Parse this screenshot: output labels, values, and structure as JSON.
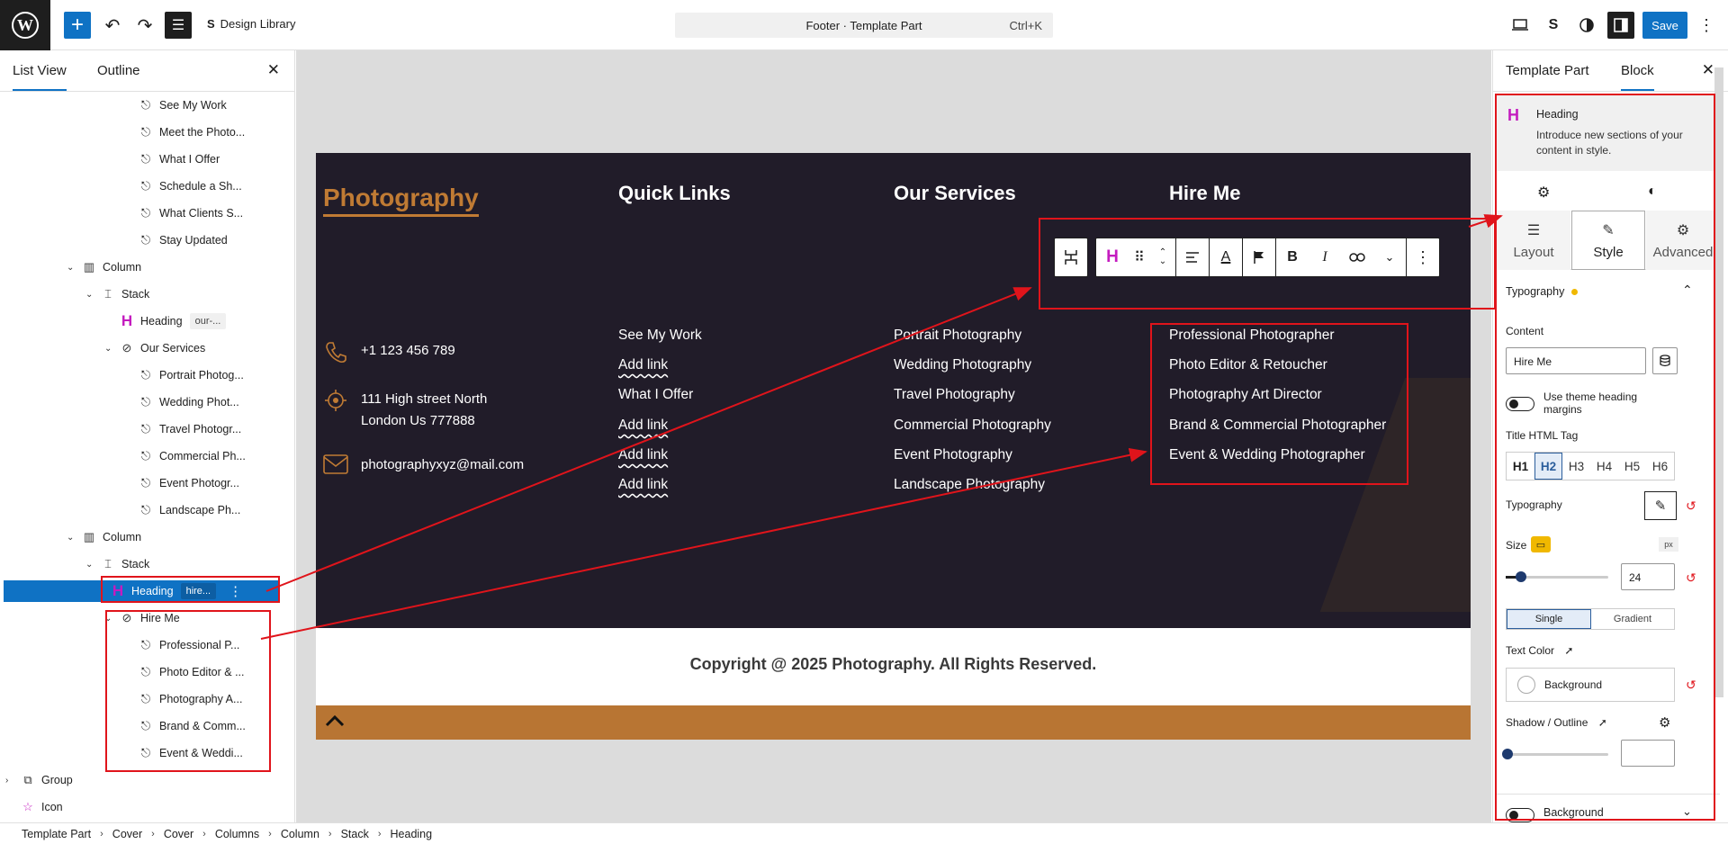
{
  "topbar": {
    "logo": "W",
    "add_icon": "+",
    "undo_icon": "↶",
    "redo_icon": "↷",
    "list_view_icon": "☰",
    "design_library_icon": "S",
    "design_library_label": "Design Library",
    "command_title": "Footer · Template Part",
    "command_shortcut": "Ctrl+K",
    "save_label": "Save"
  },
  "left_panel": {
    "tabs": [
      "List View",
      "Outline"
    ],
    "close": "✕",
    "tree": [
      {
        "label": "See My Work",
        "indent": 3,
        "icon": "link",
        "chev": ""
      },
      {
        "label": "Meet the Photo...",
        "indent": 3,
        "icon": "link",
        "chev": ""
      },
      {
        "label": "What I Offer",
        "indent": 3,
        "icon": "link",
        "chev": ""
      },
      {
        "label": "Schedule a Sh...",
        "indent": 3,
        "icon": "link",
        "chev": ""
      },
      {
        "label": "What Clients S...",
        "indent": 3,
        "icon": "link",
        "chev": ""
      },
      {
        "label": "Stay Updated",
        "indent": 3,
        "icon": "link",
        "chev": ""
      },
      {
        "label": "Column",
        "indent": 0,
        "icon": "column",
        "chev": "v"
      },
      {
        "label": "Stack",
        "indent": 1,
        "icon": "stack",
        "chev": "v"
      },
      {
        "label": "Heading",
        "indent": 2,
        "icon": "heading",
        "chev": "",
        "tag": "our-..."
      },
      {
        "label": "Our Services",
        "indent": 2,
        "icon": "nav",
        "chev": "v"
      },
      {
        "label": "Portrait Photog...",
        "indent": 3,
        "icon": "link",
        "chev": ""
      },
      {
        "label": "Wedding Phot...",
        "indent": 3,
        "icon": "link",
        "chev": ""
      },
      {
        "label": "Travel Photogr...",
        "indent": 3,
        "icon": "link",
        "chev": ""
      },
      {
        "label": "Commercial Ph...",
        "indent": 3,
        "icon": "link",
        "chev": ""
      },
      {
        "label": "Event Photogr...",
        "indent": 3,
        "icon": "link",
        "chev": ""
      },
      {
        "label": "Landscape Ph...",
        "indent": 3,
        "icon": "link",
        "chev": ""
      },
      {
        "label": "Column",
        "indent": 0,
        "icon": "column",
        "chev": "v"
      },
      {
        "label": "Stack",
        "indent": 1,
        "icon": "stack",
        "chev": "v"
      },
      {
        "label": "Heading",
        "indent": 2,
        "icon": "heading",
        "chev": "",
        "tag": "hire...",
        "selected": true
      },
      {
        "label": "Hire Me",
        "indent": 2,
        "icon": "nav",
        "chev": "v"
      },
      {
        "label": "Professional P...",
        "indent": 3,
        "icon": "link",
        "chev": ""
      },
      {
        "label": "Photo Editor & ...",
        "indent": 3,
        "icon": "link",
        "chev": ""
      },
      {
        "label": "Photography A...",
        "indent": 3,
        "icon": "link",
        "chev": ""
      },
      {
        "label": "Brand & Comm...",
        "indent": 3,
        "icon": "link",
        "chev": ""
      },
      {
        "label": "Event & Weddi...",
        "indent": 3,
        "icon": "link",
        "chev": ""
      },
      {
        "label": "Group",
        "indent": -1,
        "icon": "group",
        "chev": ">"
      },
      {
        "label": "Icon",
        "indent": -1,
        "icon": "star",
        "chev": ""
      }
    ]
  },
  "canvas": {
    "brand": "Photography",
    "contact": {
      "phone": "+1 123 456 789",
      "address_line1": "111 High street North",
      "address_line2": "London Us 777888",
      "email": "photographyxyz@mail.com"
    },
    "quick_links": {
      "heading": "Quick Links",
      "items": [
        "See My Work",
        "Add link",
        "What I Offer",
        "Add link",
        "Add link",
        "Add link"
      ]
    },
    "our_services": {
      "heading": "Our Services",
      "items": [
        "Portrait Photography",
        "Wedding Photography",
        "Travel Photography",
        "Commercial Photography",
        "Event Photography",
        "Landscape Photography"
      ]
    },
    "hire_me": {
      "heading": "Hire Me",
      "items": [
        "Professional Photographer",
        "Photo Editor & Retoucher",
        "Photography Art Director",
        "Brand & Commercial Photographer",
        "Event & Wedding Photographer"
      ]
    },
    "copyright": "Copyright @ 2025 Photography. All Rights Reserved.",
    "scroll_top_icon": "^"
  },
  "right_panel": {
    "tabs": [
      "Template Part",
      "Block"
    ],
    "close": "✕",
    "block_name": "Heading",
    "block_description": "Introduce new sections of your content in style.",
    "style_tabs": [
      "Layout",
      "Style",
      "Advanced"
    ],
    "typography_section": "Typography",
    "content_label": "Content",
    "content_value": "Hire Me",
    "theme_margins_label": "Use theme heading margins",
    "html_tag_label": "Title HTML Tag",
    "html_tags": [
      "H1",
      "H2",
      "H3",
      "H4",
      "H5",
      "H6"
    ],
    "typography_label": "Typography",
    "size_label": "Size",
    "size_unit": "px",
    "size_value": "24",
    "size_slider_fraction": 0.15,
    "color_modes": [
      "Single",
      "Gradient"
    ],
    "text_color_label": "Text Color",
    "text_color_value": "Background",
    "shadow_label": "Shadow / Outline",
    "background_label": "Background"
  },
  "breadcrumb": [
    "Template Part",
    "Cover",
    "Cover",
    "Columns",
    "Column",
    "Stack",
    "Heading"
  ],
  "colors": {
    "accent": "#0f72c4",
    "brand_orange": "#c07b34",
    "footer_bg": "#211c29",
    "annotation": "#e0141b",
    "heading_icon": "#c41cbf"
  }
}
